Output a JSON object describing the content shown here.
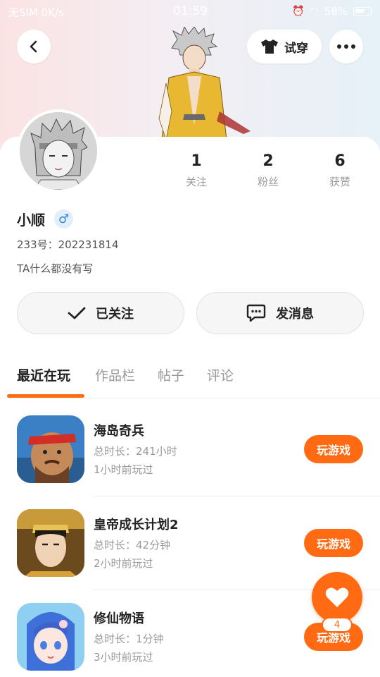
{
  "status_bar": {
    "carrier": "无SIM 0K/s",
    "time": "01:59",
    "battery": "58%"
  },
  "header": {
    "back_icon": "chevron-left-icon",
    "tryon_label": "试穿",
    "tryon_icon": "tshirt-icon",
    "more_icon": "more-dots-icon"
  },
  "profile": {
    "name": "小顺",
    "gender_symbol": "♂",
    "id_text": "233号：202231814",
    "bio": "TA什么都没有写",
    "stats": [
      {
        "value": "1",
        "label": "关注"
      },
      {
        "value": "2",
        "label": "粉丝"
      },
      {
        "value": "6",
        "label": "获赞"
      }
    ]
  },
  "actions": {
    "follow_label": "已关注",
    "message_label": "发消息"
  },
  "tabs": [
    "最近在玩",
    "作品栏",
    "帖子",
    "评论"
  ],
  "active_tab": "最近在玩",
  "games": [
    {
      "name": "海岛奇兵",
      "duration": "总时长：241小时",
      "last_played": "1小时前玩过",
      "button": "玩游戏"
    },
    {
      "name": "皇帝成长计划2",
      "duration": "总时长：42分钟",
      "last_played": "2小时前玩过",
      "button": "玩游戏"
    },
    {
      "name": "修仙物语",
      "duration": "总时长：1分钟",
      "last_played": "3小时前玩过",
      "button": "玩游戏"
    }
  ],
  "fab": {
    "icon": "heart-icon",
    "count": "4"
  },
  "colors": {
    "accent": "#ff6a13",
    "gender_blue": "#2e86de"
  }
}
